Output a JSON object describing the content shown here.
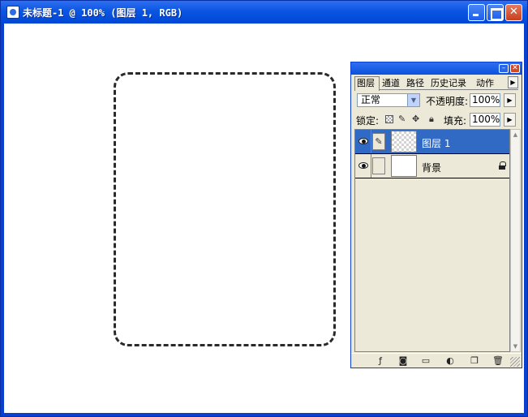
{
  "window": {
    "title": "未标题-1 @ 100% (图层 1, RGB)"
  },
  "palette": {
    "tabs": [
      "图层",
      "通道",
      "路径",
      "历史记录",
      "动作"
    ],
    "blend_mode": "正常",
    "opacity_label": "不透明度:",
    "opacity_value": "100%",
    "lock_label": "锁定:",
    "fill_label": "填充:",
    "fill_value": "100%",
    "layers": [
      {
        "name": "图层 1",
        "selected": true,
        "visible": true,
        "locked": false
      },
      {
        "name": "背景",
        "selected": false,
        "visible": true,
        "locked": true
      }
    ],
    "footer_icons": [
      "layer-style-icon",
      "layer-mask-icon",
      "new-group-icon",
      "adjustment-layer-icon",
      "new-layer-icon",
      "trash-icon"
    ]
  },
  "colors": {
    "title_bar": "#0a56e2",
    "selected_layer": "#316ac5",
    "palette_bg": "#ece9d8"
  }
}
